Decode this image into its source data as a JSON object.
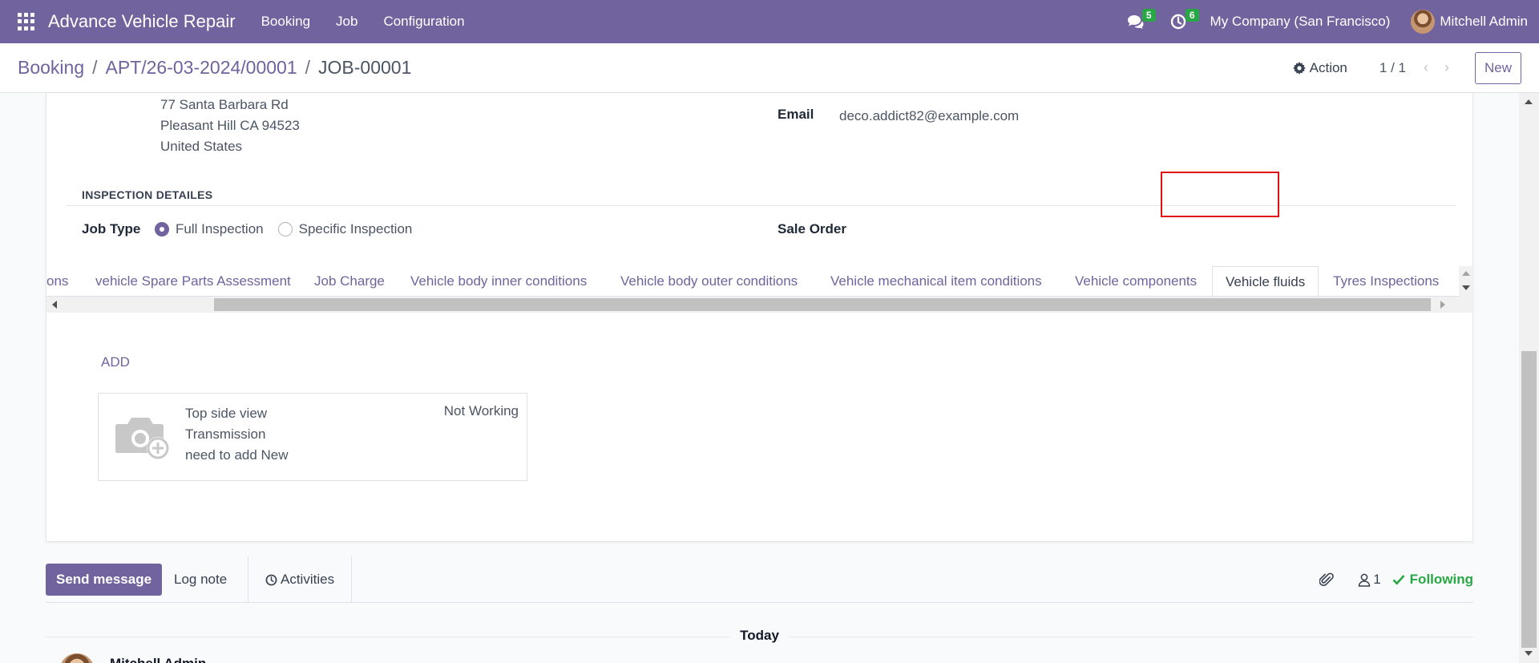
{
  "navbar": {
    "app_title": "Advance Vehicle Repair",
    "menu": [
      "Booking",
      "Job",
      "Configuration"
    ],
    "messages_count": "5",
    "activities_count": "6",
    "company": "My Company (San Francisco)",
    "user": "Mitchell Admin"
  },
  "control_panel": {
    "breadcrumb": [
      "Booking",
      "APT/26-03-2024/00001",
      "JOB-00001"
    ],
    "action_label": "Action",
    "pager": "1 / 1",
    "new_label": "New"
  },
  "form": {
    "address_lines": [
      "77 Santa Barbara Rd",
      "Pleasant Hill CA 94523",
      "United States"
    ],
    "email_label": "Email",
    "email_value": "deco.addict82@example.com",
    "section_title": "INSPECTION DETAILES",
    "job_type_label": "Job Type",
    "job_type_options": [
      "Full Inspection",
      "Specific Inspection"
    ],
    "job_type_selected": "Full Inspection",
    "sale_order_label": "Sale Order"
  },
  "tabs": [
    "ons",
    "vehicle Spare Parts Assessment",
    "Job Charge",
    "Vehicle body inner conditions",
    "Vehicle body outer conditions",
    "Vehicle mechanical item conditions",
    "Vehicle components",
    "Vehicle fluids",
    "Tyres Inspections"
  ],
  "active_tab": "Vehicle fluids",
  "tab_content": {
    "add_label": "ADD",
    "card": {
      "lines": [
        "Top side view",
        "Transmission",
        "need to add New"
      ],
      "status": "Not Working",
      "image_icon": "camera-plus-icon"
    }
  },
  "chatter": {
    "send_message": "Send message",
    "log_note": "Log note",
    "activities": "Activities",
    "followers_count": "1",
    "following": "Following",
    "date_separator": "Today",
    "message_author": "Mitchell Admin"
  },
  "colors": {
    "brand": "#71639e",
    "success": "#28a745",
    "highlight": "#e01010"
  }
}
